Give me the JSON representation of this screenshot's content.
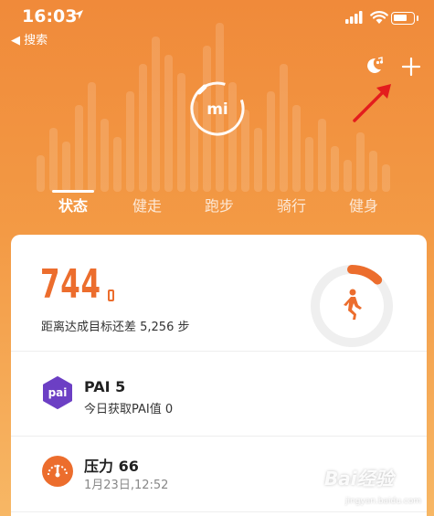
{
  "status_bar": {
    "time": "16:03",
    "back_label": "◀ 搜索"
  },
  "header": {
    "logo_text": "mi"
  },
  "tabs": [
    {
      "label": "状态",
      "active": true
    },
    {
      "label": "健走"
    },
    {
      "label": "跑步"
    },
    {
      "label": "骑行"
    },
    {
      "label": "健身"
    }
  ],
  "steps_card": {
    "steps": "744",
    "goal_text": "距离达成目标还差 5,256 步",
    "progress_fraction": 0.124
  },
  "items": [
    {
      "icon": "pai-icon",
      "icon_text": "pai",
      "title": "PAI 5",
      "subtitle": "今日获取PAI值 0"
    },
    {
      "icon": "stress-gauge-icon",
      "title": "压力 66",
      "subtitle": "1月23日,12:52"
    }
  ],
  "watermark": {
    "text": "Bai经验",
    "subtext": "jingyan.baidu.com"
  },
  "colors": {
    "accent": "#ec6d2d",
    "header_top": "#f08a3a",
    "pai_purple": "#6c3fc4"
  }
}
